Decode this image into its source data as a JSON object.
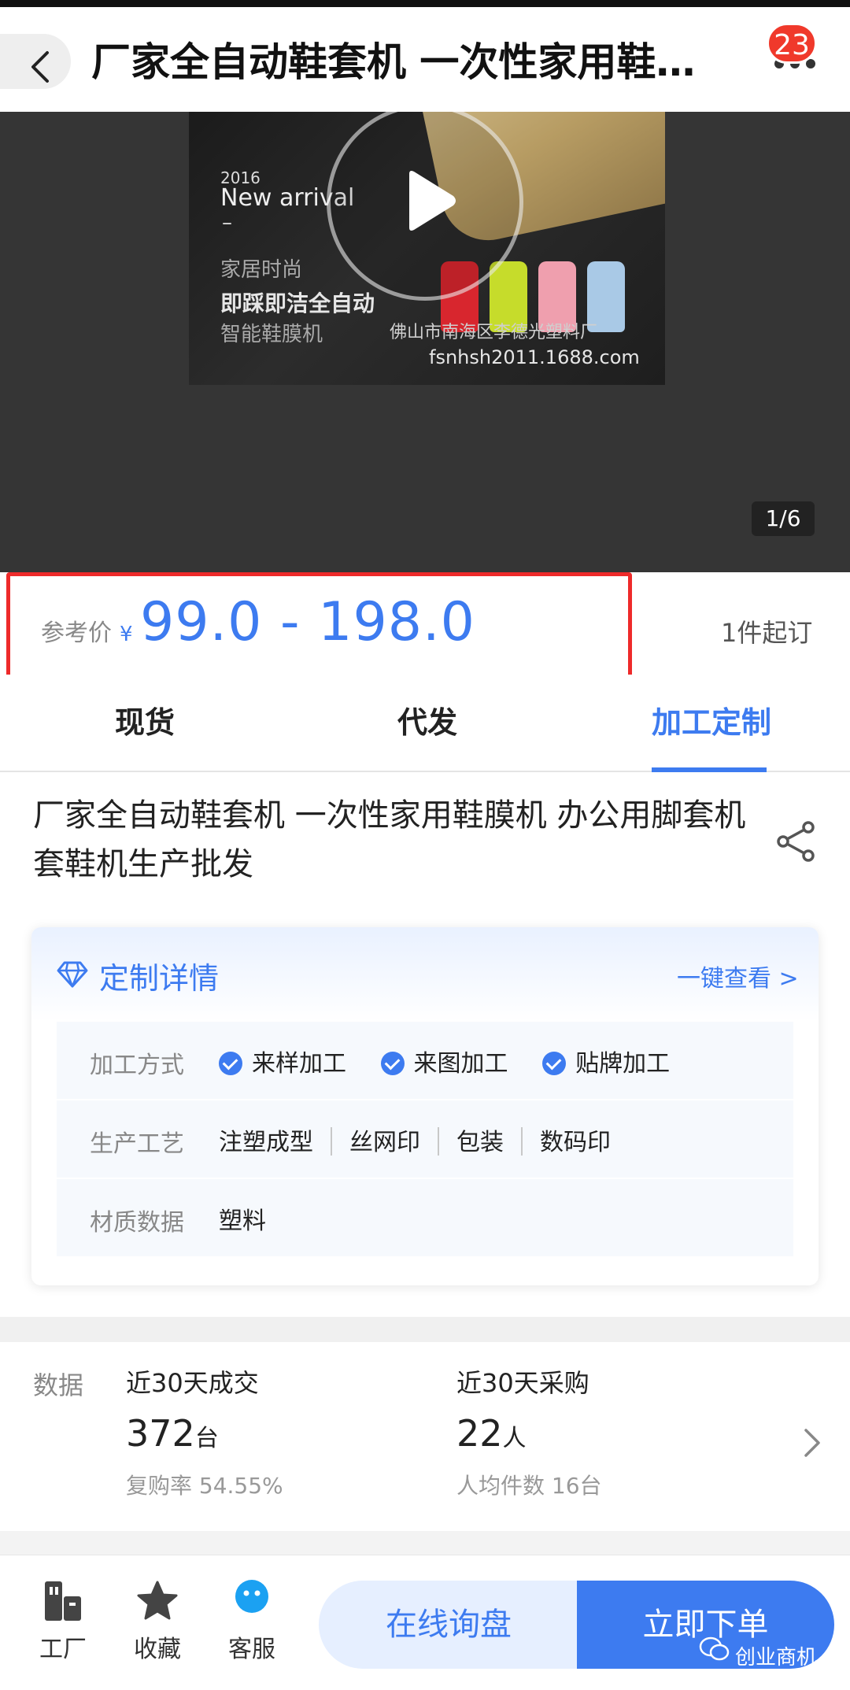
{
  "header": {
    "title": "厂家全自动鞋套机 一次性家用鞋膜...",
    "badge_count": "23"
  },
  "media": {
    "promo_year": "2016",
    "promo_arrival": "New arrival",
    "promo_dash": "–",
    "promo_line1": "家居时尚",
    "promo_line2": "即踩即洁全自动",
    "promo_line3": "智能鞋膜机",
    "promo_company": "佛山市南海区李德光塑料厂",
    "promo_url": "fsnhsh2011.1688.com",
    "page_indicator": "1/6"
  },
  "price": {
    "label": "参考价",
    "currency": "¥",
    "value": "99.0 - 198.0",
    "min_order": "1件起订"
  },
  "tabs": [
    {
      "label": "现货"
    },
    {
      "label": "代发"
    },
    {
      "label": "加工定制"
    }
  ],
  "product": {
    "title": "厂家全自动鞋套机 一次性家用鞋膜机 办公用脚套机套鞋机生产批发"
  },
  "custom_details": {
    "title": "定制详情",
    "link": "一键查看 >",
    "rows": [
      {
        "label": "加工方式",
        "values": [
          "来样加工",
          "来图加工",
          "贴牌加工"
        ]
      },
      {
        "label": "生产工艺",
        "values": [
          "注塑成型",
          "丝网印",
          "包装",
          "数码印"
        ]
      },
      {
        "label": "材质数据",
        "values": [
          "塑料"
        ]
      }
    ]
  },
  "data_section": {
    "label": "数据",
    "stats": [
      {
        "title": "近30天成交",
        "number": "372",
        "unit": "台",
        "sub": "复购率 54.55%"
      },
      {
        "title": "近30天采购",
        "number": "22",
        "unit": "人",
        "sub": "人均件数 16台"
      }
    ]
  },
  "bottom_bar": {
    "nav": [
      {
        "label": "工厂",
        "icon": "factory-icon"
      },
      {
        "label": "收藏",
        "icon": "star-icon"
      },
      {
        "label": "客服",
        "icon": "customer-service-icon"
      }
    ],
    "inquiry_label": "在线询盘",
    "order_label": "立即下单"
  },
  "watermark": "创业商机",
  "colors": {
    "accent": "#3d7bf0",
    "highlight_box": "#ee2a2a",
    "badge": "#f0392b",
    "media_bg": "#353535"
  }
}
